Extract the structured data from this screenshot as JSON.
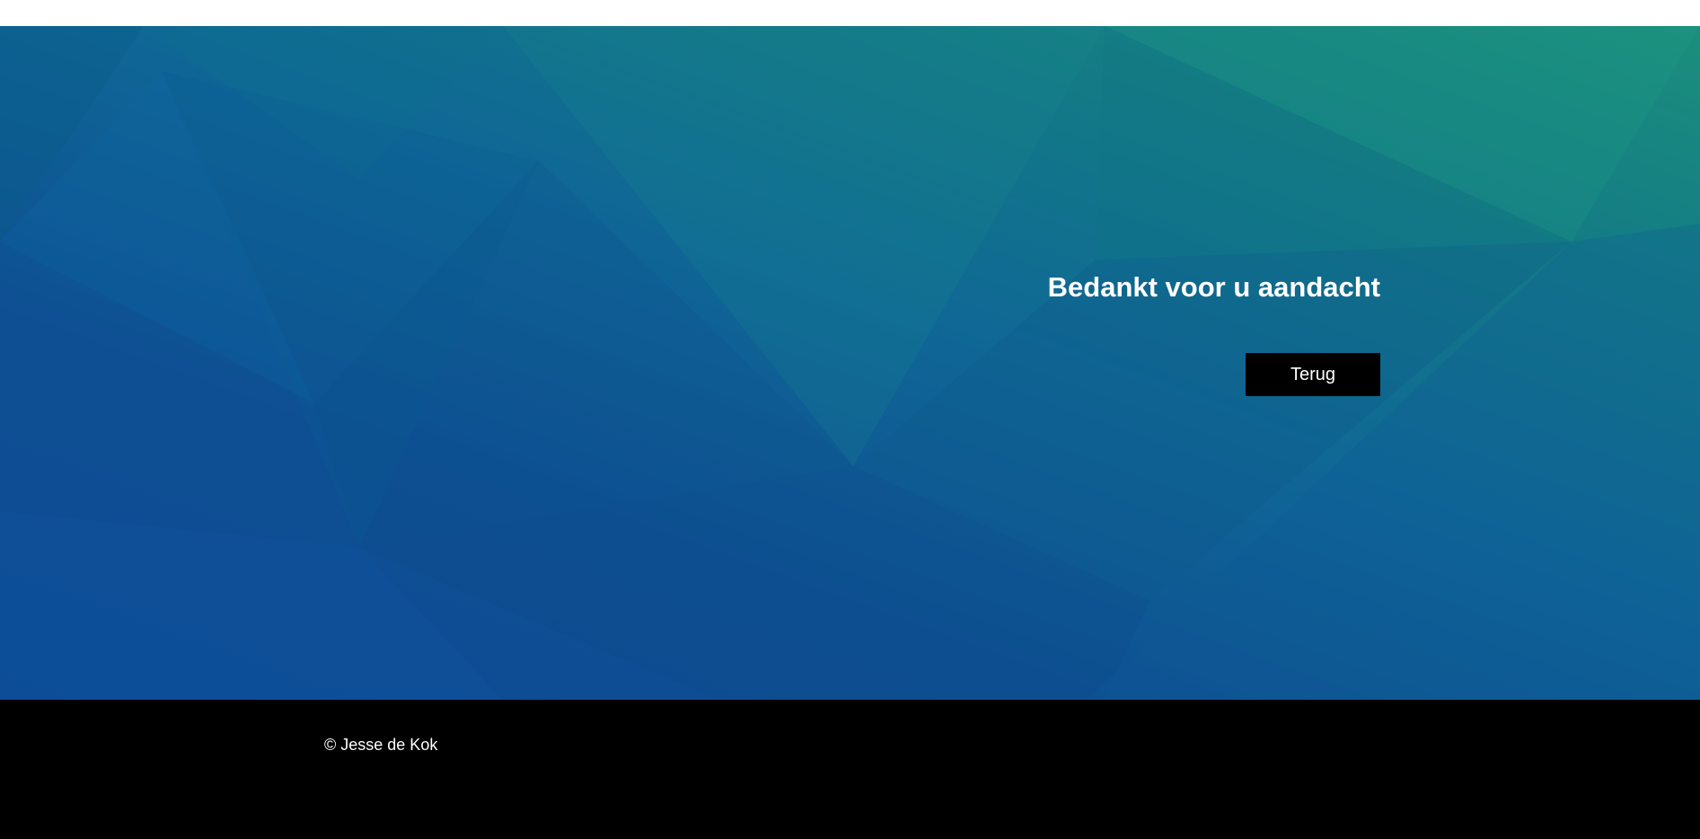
{
  "hero": {
    "title": "Bedankt voor u aandacht",
    "back_button_label": "Terug"
  },
  "footer": {
    "copyright": "© Jesse de Kok"
  },
  "colors": {
    "button_background": "#000000",
    "footer_background": "#000000",
    "text": "#ffffff",
    "hero_gradient_top": "#1b8f7c",
    "hero_gradient_bottom": "#0d4a94"
  }
}
